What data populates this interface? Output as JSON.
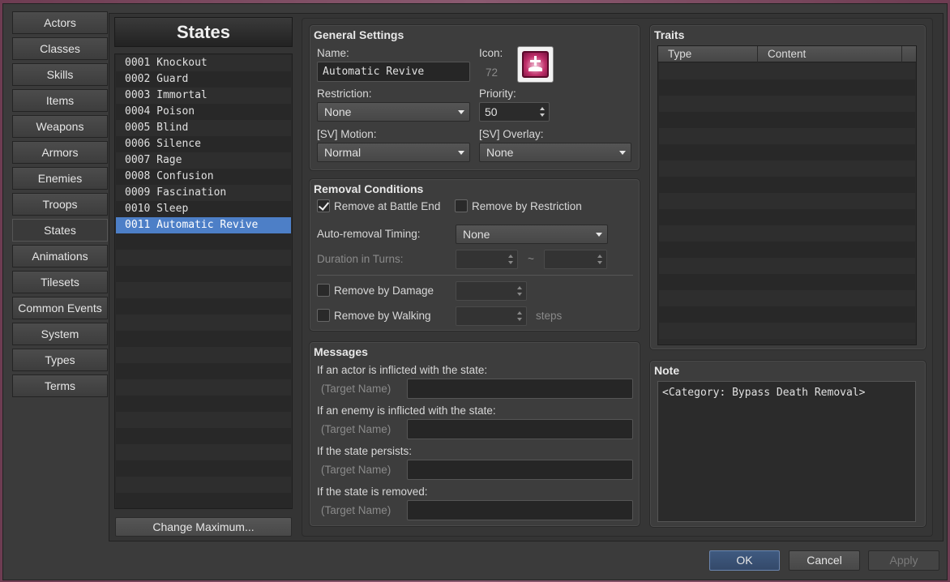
{
  "categories": [
    {
      "label": "Actors"
    },
    {
      "label": "Classes"
    },
    {
      "label": "Skills"
    },
    {
      "label": "Items"
    },
    {
      "label": "Weapons"
    },
    {
      "label": "Armors"
    },
    {
      "label": "Enemies"
    },
    {
      "label": "Troops"
    },
    {
      "label": "States"
    },
    {
      "label": "Animations"
    },
    {
      "label": "Tilesets"
    },
    {
      "label": "Common Events"
    },
    {
      "label": "System"
    },
    {
      "label": "Types"
    },
    {
      "label": "Terms"
    }
  ],
  "list": {
    "title": "States",
    "items": [
      {
        "label": "0001 Knockout"
      },
      {
        "label": "0002 Guard"
      },
      {
        "label": "0003 Immortal"
      },
      {
        "label": "0004 Poison"
      },
      {
        "label": "0005 Blind"
      },
      {
        "label": "0006 Silence"
      },
      {
        "label": "0007 Rage"
      },
      {
        "label": "0008 Confusion"
      },
      {
        "label": "0009 Fascination"
      },
      {
        "label": "0010 Sleep"
      },
      {
        "label": "0011 Automatic Revive"
      }
    ],
    "change_max": "Change Maximum..."
  },
  "general": {
    "title": "General Settings",
    "name_label": "Name:",
    "name_value": "Automatic Revive",
    "icon_label": "Icon:",
    "icon_index": "72",
    "restriction_label": "Restriction:",
    "restriction_value": "None",
    "priority_label": "Priority:",
    "priority_value": "50",
    "motion_label": "[SV] Motion:",
    "motion_value": "Normal",
    "overlay_label": "[SV] Overlay:",
    "overlay_value": "None"
  },
  "removal": {
    "title": "Removal Conditions",
    "battle_end": "Remove at Battle End",
    "restriction": "Remove by Restriction",
    "timing_label": "Auto-removal Timing:",
    "timing_value": "None",
    "duration_label": "Duration in Turns:",
    "tilde": "~",
    "damage": "Remove by Damage",
    "walking": "Remove by Walking",
    "steps": "steps"
  },
  "messages": {
    "title": "Messages",
    "m1": "If an actor is inflicted with the state:",
    "m2": "If an enemy is inflicted with the state:",
    "m3": "If the state persists:",
    "m4": "If the state is removed:",
    "target": "(Target Name)"
  },
  "traits": {
    "title": "Traits",
    "col_type": "Type",
    "col_content": "Content"
  },
  "note": {
    "title": "Note",
    "text": "<Category: Bypass Death Removal>"
  },
  "footer": {
    "ok": "OK",
    "cancel": "Cancel",
    "apply": "Apply"
  },
  "colors": {
    "selection": "#4d7fc7",
    "ok_button": "#3f5a80"
  }
}
